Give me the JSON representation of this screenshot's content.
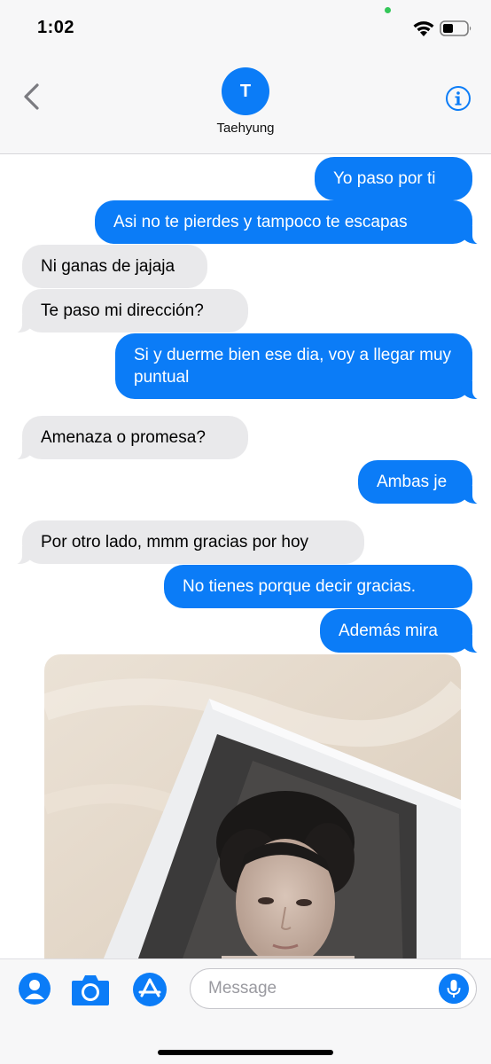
{
  "status_bar": {
    "time": "1:02"
  },
  "header": {
    "avatar_initial": "T",
    "contact_name": "Taehyung"
  },
  "messages": [
    {
      "text": "Yo paso por ti",
      "from": "me"
    },
    {
      "text": "Asi no te pierdes y tampoco te escapas",
      "from": "me"
    },
    {
      "text": "Ni ganas de jajaja",
      "from": "them"
    },
    {
      "text": "Te paso mi dirección?",
      "from": "them"
    },
    {
      "text": "Si y duerme bien ese dia, voy a llegar muy puntual",
      "from": "me"
    },
    {
      "text": "Amenaza o promesa?",
      "from": "them"
    },
    {
      "text": "Ambas je",
      "from": "me"
    },
    {
      "text": "Por otro lado, mmm gracias por hoy",
      "from": "them"
    },
    {
      "text": "No tienes porque decir gracias.",
      "from": "me"
    },
    {
      "text": "Además mira",
      "from": "me"
    }
  ],
  "composer": {
    "placeholder": "Message"
  },
  "colors": {
    "accent": "#0b7cf7",
    "received_bubble": "#e9e9eb",
    "status_dot": "#34c759"
  },
  "icons": [
    "back-chevron-icon",
    "info-icon",
    "contacts-icon",
    "camera-icon",
    "app-store-icon",
    "microphone-icon",
    "wifi-icon",
    "battery-icon"
  ]
}
